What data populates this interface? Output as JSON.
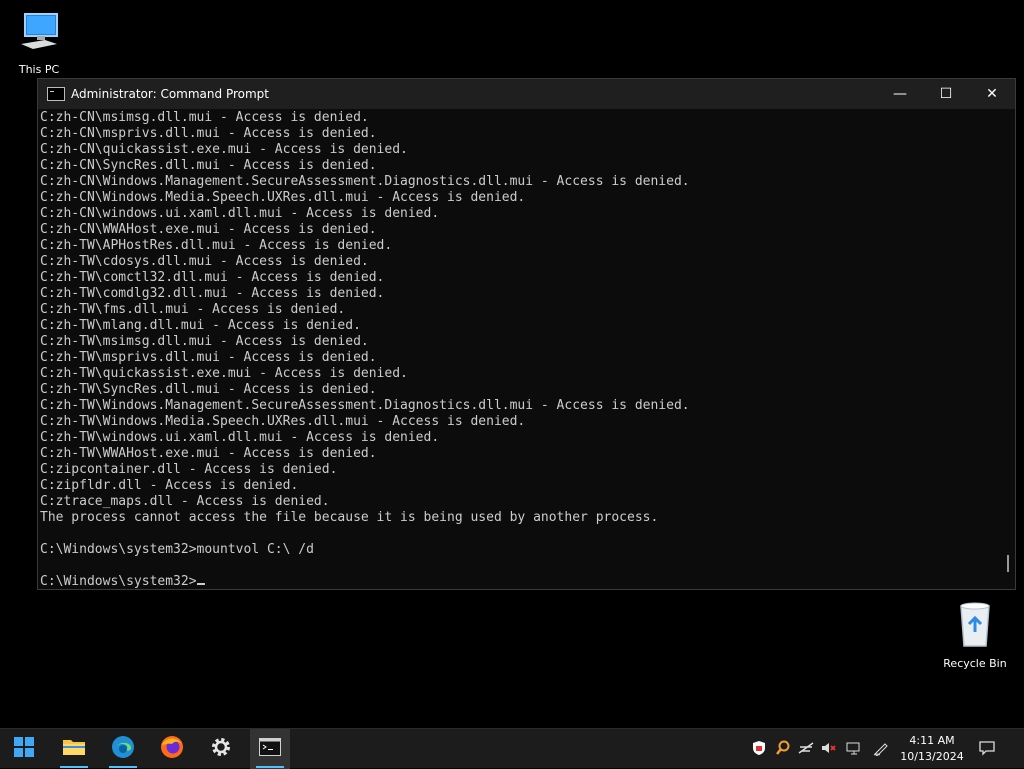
{
  "desktop": {
    "icons": [
      {
        "label": "This PC",
        "icon": "monitor-icon"
      },
      {
        "label": "Recycle Bin",
        "icon": "recycle-bin-icon"
      }
    ]
  },
  "window": {
    "title": "Administrator: Command Prompt",
    "controls": {
      "minimize": "—",
      "maximize": "☐",
      "close": "✕"
    }
  },
  "console": {
    "lines": [
      "C:zh-CN\\msimsg.dll.mui - Access is denied.",
      "C:zh-CN\\msprivs.dll.mui - Access is denied.",
      "C:zh-CN\\quickassist.exe.mui - Access is denied.",
      "C:zh-CN\\SyncRes.dll.mui - Access is denied.",
      "C:zh-CN\\Windows.Management.SecureAssessment.Diagnostics.dll.mui - Access is denied.",
      "C:zh-CN\\Windows.Media.Speech.UXRes.dll.mui - Access is denied.",
      "C:zh-CN\\windows.ui.xaml.dll.mui - Access is denied.",
      "C:zh-CN\\WWAHost.exe.mui - Access is denied.",
      "C:zh-TW\\APHostRes.dll.mui - Access is denied.",
      "C:zh-TW\\cdosys.dll.mui - Access is denied.",
      "C:zh-TW\\comctl32.dll.mui - Access is denied.",
      "C:zh-TW\\comdlg32.dll.mui - Access is denied.",
      "C:zh-TW\\fms.dll.mui - Access is denied.",
      "C:zh-TW\\mlang.dll.mui - Access is denied.",
      "C:zh-TW\\msimsg.dll.mui - Access is denied.",
      "C:zh-TW\\msprivs.dll.mui - Access is denied.",
      "C:zh-TW\\quickassist.exe.mui - Access is denied.",
      "C:zh-TW\\SyncRes.dll.mui - Access is denied.",
      "C:zh-TW\\Windows.Management.SecureAssessment.Diagnostics.dll.mui - Access is denied.",
      "C:zh-TW\\Windows.Media.Speech.UXRes.dll.mui - Access is denied.",
      "C:zh-TW\\windows.ui.xaml.dll.mui - Access is denied.",
      "C:zh-TW\\WWAHost.exe.mui - Access is denied.",
      "C:zipcontainer.dll - Access is denied.",
      "C:zipfldr.dll - Access is denied.",
      "C:ztrace_maps.dll - Access is denied.",
      "The process cannot access the file because it is being used by another process.",
      "",
      "C:\\Windows\\system32>mountvol C:\\ /d",
      ""
    ],
    "prompt": "C:\\Windows\\system32>"
  },
  "taskbar": {
    "apps": [
      {
        "name": "start",
        "icon": "windows-start-icon"
      },
      {
        "name": "file-explorer",
        "icon": "folder-icon"
      },
      {
        "name": "edge",
        "icon": "edge-icon"
      },
      {
        "name": "firefox",
        "icon": "firefox-icon"
      },
      {
        "name": "settings",
        "icon": "gear-icon"
      },
      {
        "name": "command-prompt",
        "icon": "terminal-icon"
      }
    ],
    "clock": {
      "time": "4:11 AM",
      "date": "10/13/2024"
    }
  },
  "colors": {
    "console_bg": "#0c0c0c",
    "console_text": "#cccccc",
    "taskbar_bg": "#1c1c1c",
    "accent": "#4cc2ff"
  }
}
